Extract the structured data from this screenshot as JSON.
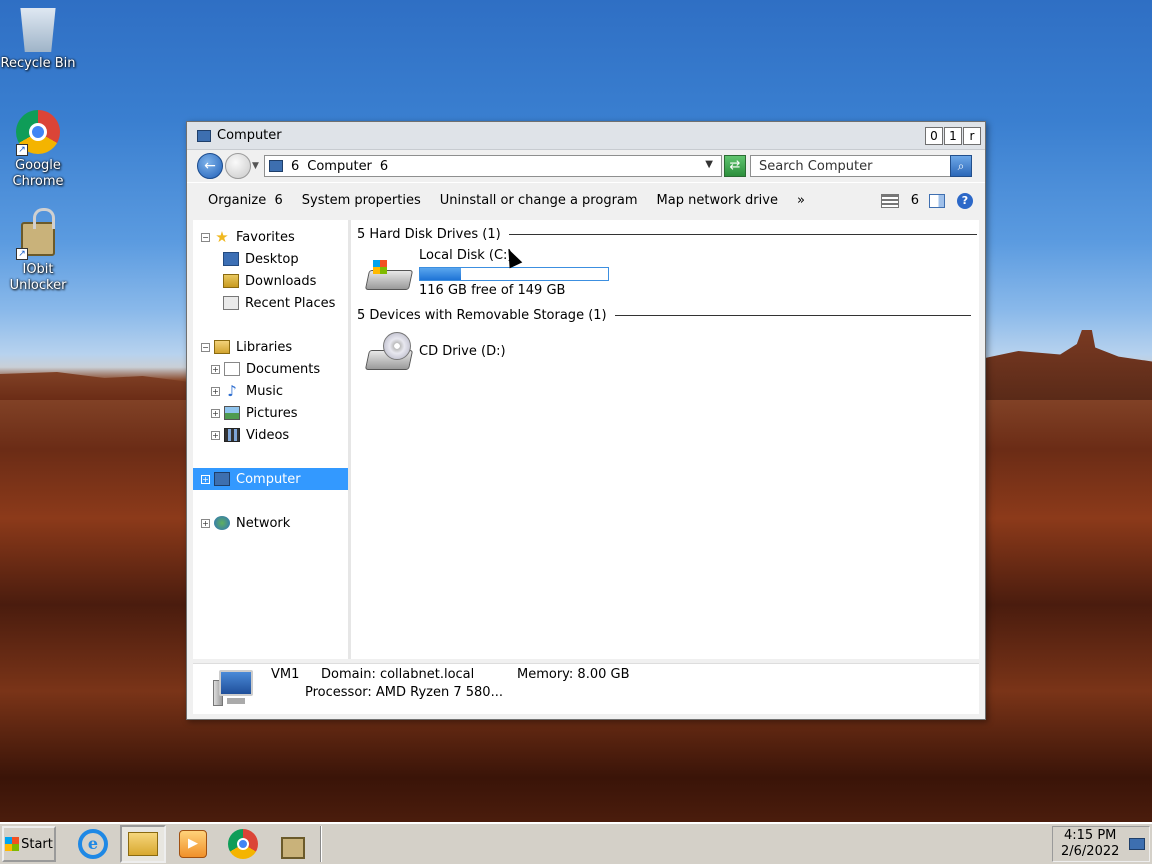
{
  "desktop": {
    "icons": [
      {
        "label": "Recycle Bin",
        "icon": "recycle-bin-icon"
      },
      {
        "label": "Google Chrome",
        "icon": "chrome-icon"
      },
      {
        "label": "IObit Unlocker",
        "icon": "iobit-unlocker-icon"
      }
    ]
  },
  "window": {
    "title": "Computer",
    "buttons": {
      "minimize": "0",
      "maximize": "1",
      "close": "r"
    },
    "address": {
      "sep": "6",
      "path": "Computer",
      "sep2": "6"
    },
    "search": {
      "placeholder": "Search Computer"
    },
    "toolbar": {
      "organize": "Organize",
      "organize_arrow": "6",
      "system_properties": "System properties",
      "uninstall": "Uninstall or change a program",
      "map_drive": "Map network drive",
      "more": "»",
      "views_arrow": "6",
      "help": "?"
    },
    "nav": {
      "favorites": "Favorites",
      "desktop": "Desktop",
      "downloads": "Downloads",
      "recent_places": "Recent Places",
      "libraries": "Libraries",
      "documents": "Documents",
      "music": "Music",
      "pictures": "Pictures",
      "videos": "Videos",
      "computer": "Computer",
      "network": "Network"
    },
    "groups": {
      "hard_disks": {
        "header": "5 Hard Disk Drives (1)"
      },
      "removable": {
        "header": "5 Devices with Removable Storage (1)"
      }
    },
    "drives": {
      "local_disk": {
        "name": "Local Disk (C:)",
        "free": "116 GB free of 149 GB",
        "used_fraction": 0.22
      },
      "cd_drive": {
        "name": "CD Drive (D:)"
      }
    },
    "details": {
      "name": "VM1",
      "domain": "Domain: collabnet.local",
      "memory": "Memory: 8.00 GB",
      "processor": "Processor: AMD Ryzen 7 580..."
    }
  },
  "taskbar": {
    "start": "Start",
    "time": "4:15 PM",
    "date": "2/6/2022",
    "apps": [
      "internet-explorer-icon",
      "file-explorer-icon",
      "media-player-icon",
      "chrome-icon",
      "iobit-unlocker-icon"
    ]
  },
  "colors": {
    "selection": "#3399ff",
    "progress": "#1f74d6"
  }
}
